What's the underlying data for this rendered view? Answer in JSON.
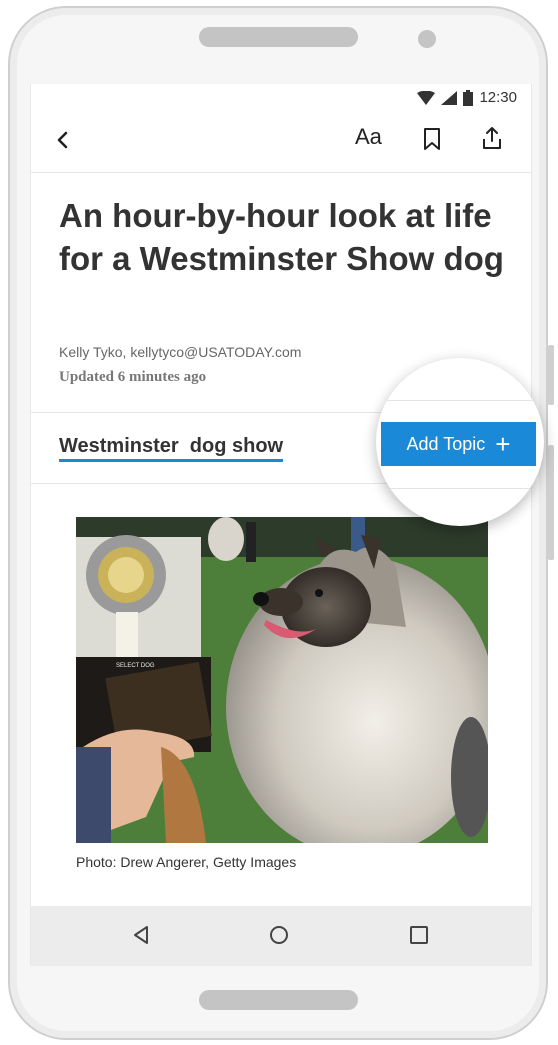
{
  "status": {
    "time": "12:30"
  },
  "toolbar": {
    "text_size_label": "Aa"
  },
  "article": {
    "headline": "An hour-by-hour look at life for a Westminster Show dog",
    "byline": "Kelly Tyko, kellytyco@USATODAY.com",
    "updated": "Updated 6 minutes ago",
    "topic": "Westminster  dog show",
    "add_topic_label": "Add Topic",
    "add_topic_icon": "+",
    "caption": "Photo: Drew Angerer, Getty Images",
    "ribbon_text": "SELECT DOG"
  },
  "colors": {
    "accent": "#1a8ad8",
    "headline": "#333333"
  },
  "icons": [
    "back-arrow-icon",
    "bookmark-icon",
    "share-icon",
    "wifi-icon",
    "signal-icon",
    "battery-icon",
    "nav-back-icon",
    "nav-home-icon",
    "nav-recent-icon",
    "plus-icon"
  ]
}
